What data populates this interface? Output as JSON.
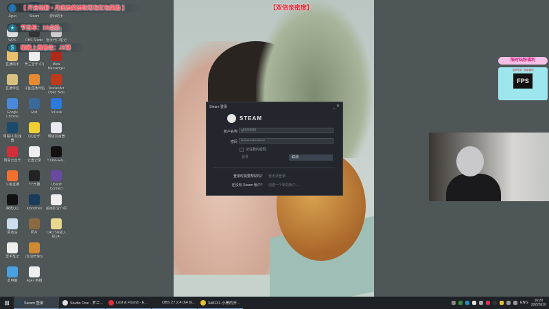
{
  "overlay": {
    "caption": "【双倍亲密度】",
    "banners": [
      {
        "icon": "user-icon",
        "glyph": "👤",
        "text": "【 开启钻粉 • 月底抽奖抽取还有红包奖励 】"
      },
      {
        "icon": "star-icon",
        "glyph": "★",
        "text": "节目单：10点杀"
      },
      {
        "icon": "dollar-icon",
        "glyph": "$",
        "text": "碰碰上周最佳：JZ哥"
      }
    ],
    "widget": {
      "title": "限时钻粉福利",
      "line": "钻粉专属 · 超级福利",
      "fps_logo": "FPS"
    }
  },
  "desktop_icons": [
    {
      "label": "Jiguo",
      "color": "#555"
    },
    {
      "label": "Steam",
      "color": "#2a3f5a"
    },
    {
      "label": "游戏助手",
      "color": "#666"
    },
    {
      "label": "WPS",
      "color": "#ddd"
    },
    {
      "label": "OBS Studio",
      "color": "#333"
    },
    {
      "label": "雷手开口笔记",
      "color": "#ccc"
    },
    {
      "label": "直播助手",
      "color": "#e8c070"
    },
    {
      "label": "罗兰音乐 (D)",
      "color": "#eee"
    },
    {
      "label": "Meta Messenger",
      "color": "#b02a1a"
    },
    {
      "label": "直播伴侣",
      "color": "#d8c080"
    },
    {
      "label": "斗鱼直播伴侣",
      "color": "#e88a30"
    },
    {
      "label": "Warlander Open Beta",
      "color": "#c03a1a"
    },
    {
      "label": "Google Chrome",
      "color": "#4a8ad8"
    },
    {
      "label": "Raft",
      "color": "#3a6a9a"
    },
    {
      "label": "ToDesk",
      "color": "#2a7ae0"
    },
    {
      "label": "网易UU加速器",
      "color": "#1a4a6a"
    },
    {
      "label": "QQ音乐",
      "color": "#f0d030"
    },
    {
      "label": "网络加速器",
      "color": "#e8e8f0"
    },
    {
      "label": "网易云音乐",
      "color": "#d0303a"
    },
    {
      "label": "云盘记录",
      "color": "#eee"
    },
    {
      "label": "Y1966-RA...",
      "color": "#111"
    },
    {
      "label": "斗鱼直播",
      "color": "#f07030"
    },
    {
      "label": "YY开播",
      "color": "#222"
    },
    {
      "label": "Ubisoft Connect",
      "color": "#6a4aa0"
    },
    {
      "label": "腾讯QQ",
      "color": "#111"
    },
    {
      "label": "Kmodman",
      "color": "#1a3a5a"
    },
    {
      "label": "超级职业介绍",
      "color": "#eee"
    },
    {
      "label": "回收站",
      "color": "#cde"
    },
    {
      "label": "照片",
      "color": "#8a6a40"
    },
    {
      "label": "CAD SN插入帖 (4)",
      "color": "#e8d890"
    },
    {
      "label": "雷手笔记",
      "color": "#eee"
    },
    {
      "label": "(仙剑奇侠5)",
      "color": "#d08a30"
    },
    null,
    {
      "label": "此电脑",
      "color": "#4aa0e0"
    },
    {
      "label": "Apex 英雄",
      "color": "#eee"
    },
    null
  ],
  "steam_login": {
    "window_title": "Steam 登录",
    "brand": "STEAM",
    "window_controls": "_ ✕",
    "account_label": "帐户名称",
    "account_value": "q8888888",
    "password_label": "密码",
    "password_value": "••••••••••••••••••••",
    "remember_label": "记住我的密码",
    "login_button": "登录",
    "cancel_button": "取消",
    "help_question": "登录时需要帮助吗？",
    "help_link": "我无法登录…",
    "no_account_question": "还没有 Steam 帐户？",
    "create_link": "创建一个新的帐户…"
  },
  "taskbar": {
    "items": [
      {
        "label": "Steam 登录",
        "color": "#2a475e",
        "active": true
      },
      {
        "label": "Studio One - 罗兰...",
        "color": "#ddd",
        "active": false
      },
      {
        "label": "Lost & Found - E...",
        "color": "#e0303a",
        "active": false
      },
      {
        "label": "OBS 27.2.4 (64 bi...",
        "color": "#222",
        "active": false
      },
      {
        "label": "348131-小黑的开...",
        "color": "#e8c030",
        "active": false
      }
    ],
    "tray": {
      "lang": "ENG",
      "time": "16:20",
      "date": "2022/9/16"
    }
  }
}
